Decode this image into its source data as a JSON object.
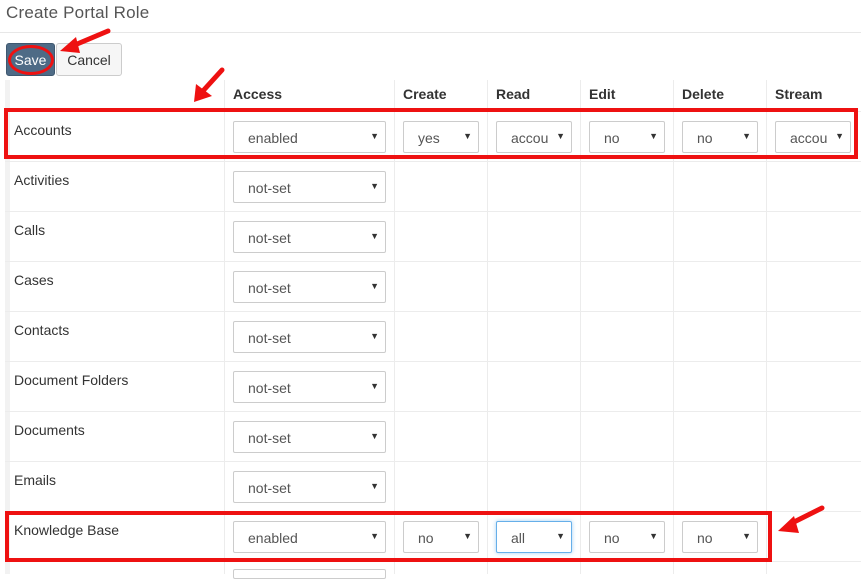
{
  "page": {
    "title": "Create Portal Role"
  },
  "toolbar": {
    "save_label": "Save",
    "cancel_label": "Cancel"
  },
  "columns": {
    "access": "Access",
    "create": "Create",
    "read": "Read",
    "edit": "Edit",
    "delete": "Delete",
    "stream": "Stream"
  },
  "rows": [
    {
      "label": "Accounts",
      "access": "enabled",
      "create": "yes",
      "read": "accou",
      "edit": "no",
      "delete": "no",
      "stream": "accou"
    },
    {
      "label": "Activities",
      "access": "not-set"
    },
    {
      "label": "Calls",
      "access": "not-set"
    },
    {
      "label": "Cases",
      "access": "not-set"
    },
    {
      "label": "Contacts",
      "access": "not-set"
    },
    {
      "label": "Document Folders",
      "access": "not-set"
    },
    {
      "label": "Documents",
      "access": "not-set"
    },
    {
      "label": "Emails",
      "access": "not-set"
    },
    {
      "label": "Knowledge Base",
      "access": "enabled",
      "create": "no",
      "read": "all",
      "edit": "no",
      "delete": "no"
    }
  ],
  "icons": {
    "dropdown_caret": "caret-down-icon"
  },
  "colors": {
    "save_button": "#4e6b86",
    "annotation": "#ee1111",
    "focus": "#66afe9"
  }
}
